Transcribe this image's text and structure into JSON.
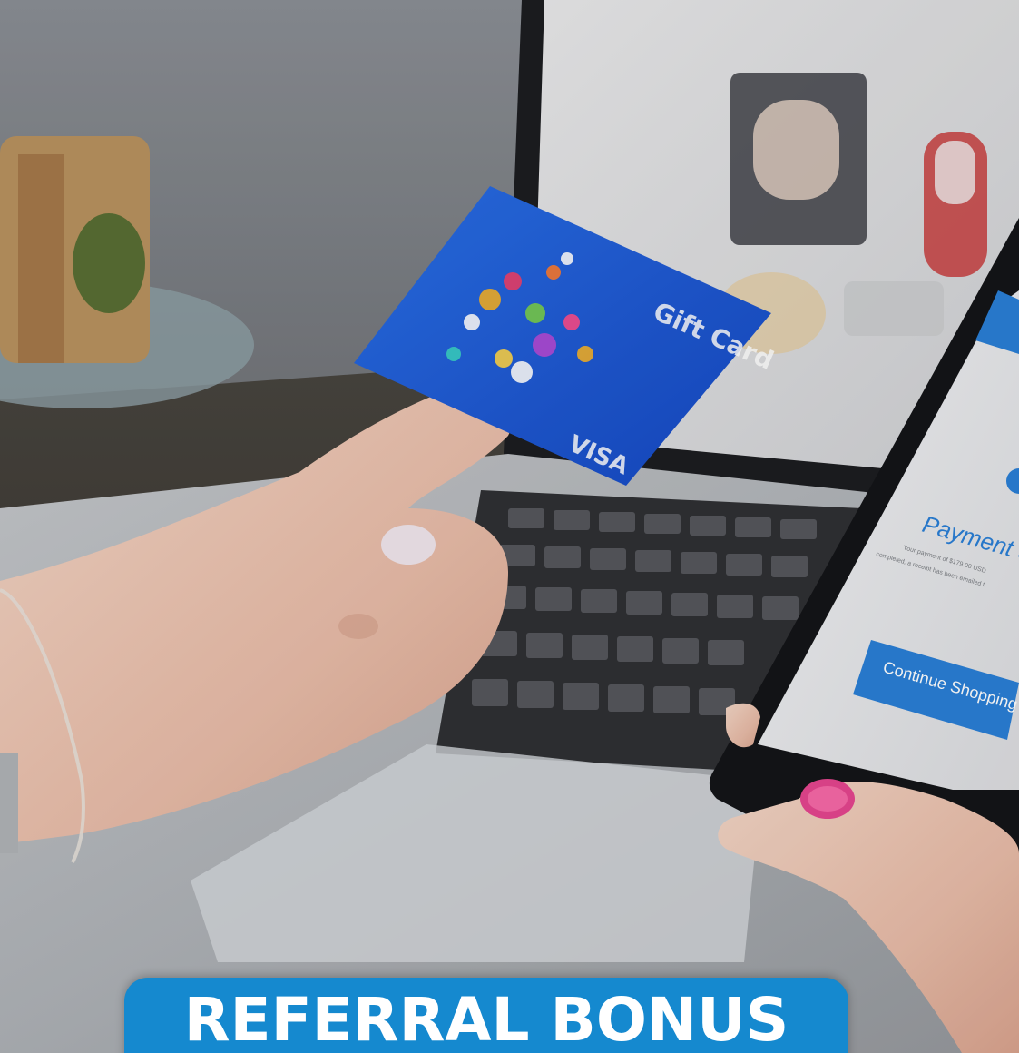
{
  "banner": {
    "title": "REFERRAL BONUS",
    "color": "#1589cf",
    "text_color": "#ffffff"
  },
  "phone_screen": {
    "heading": "Payment S",
    "body_line_1": "Your payment of $179.00 USD",
    "body_line_2": "completed, a receipt has been emailed t",
    "button_label": "Continue Shopping",
    "accent_color": "#2a7fd6"
  },
  "card": {
    "brand_text": "VISA",
    "corner_text": "Gift Card",
    "color": "#1f5fd8"
  },
  "scene": {
    "icons": [
      "credit-card-icon",
      "smartphone-icon",
      "laptop-icon"
    ]
  }
}
